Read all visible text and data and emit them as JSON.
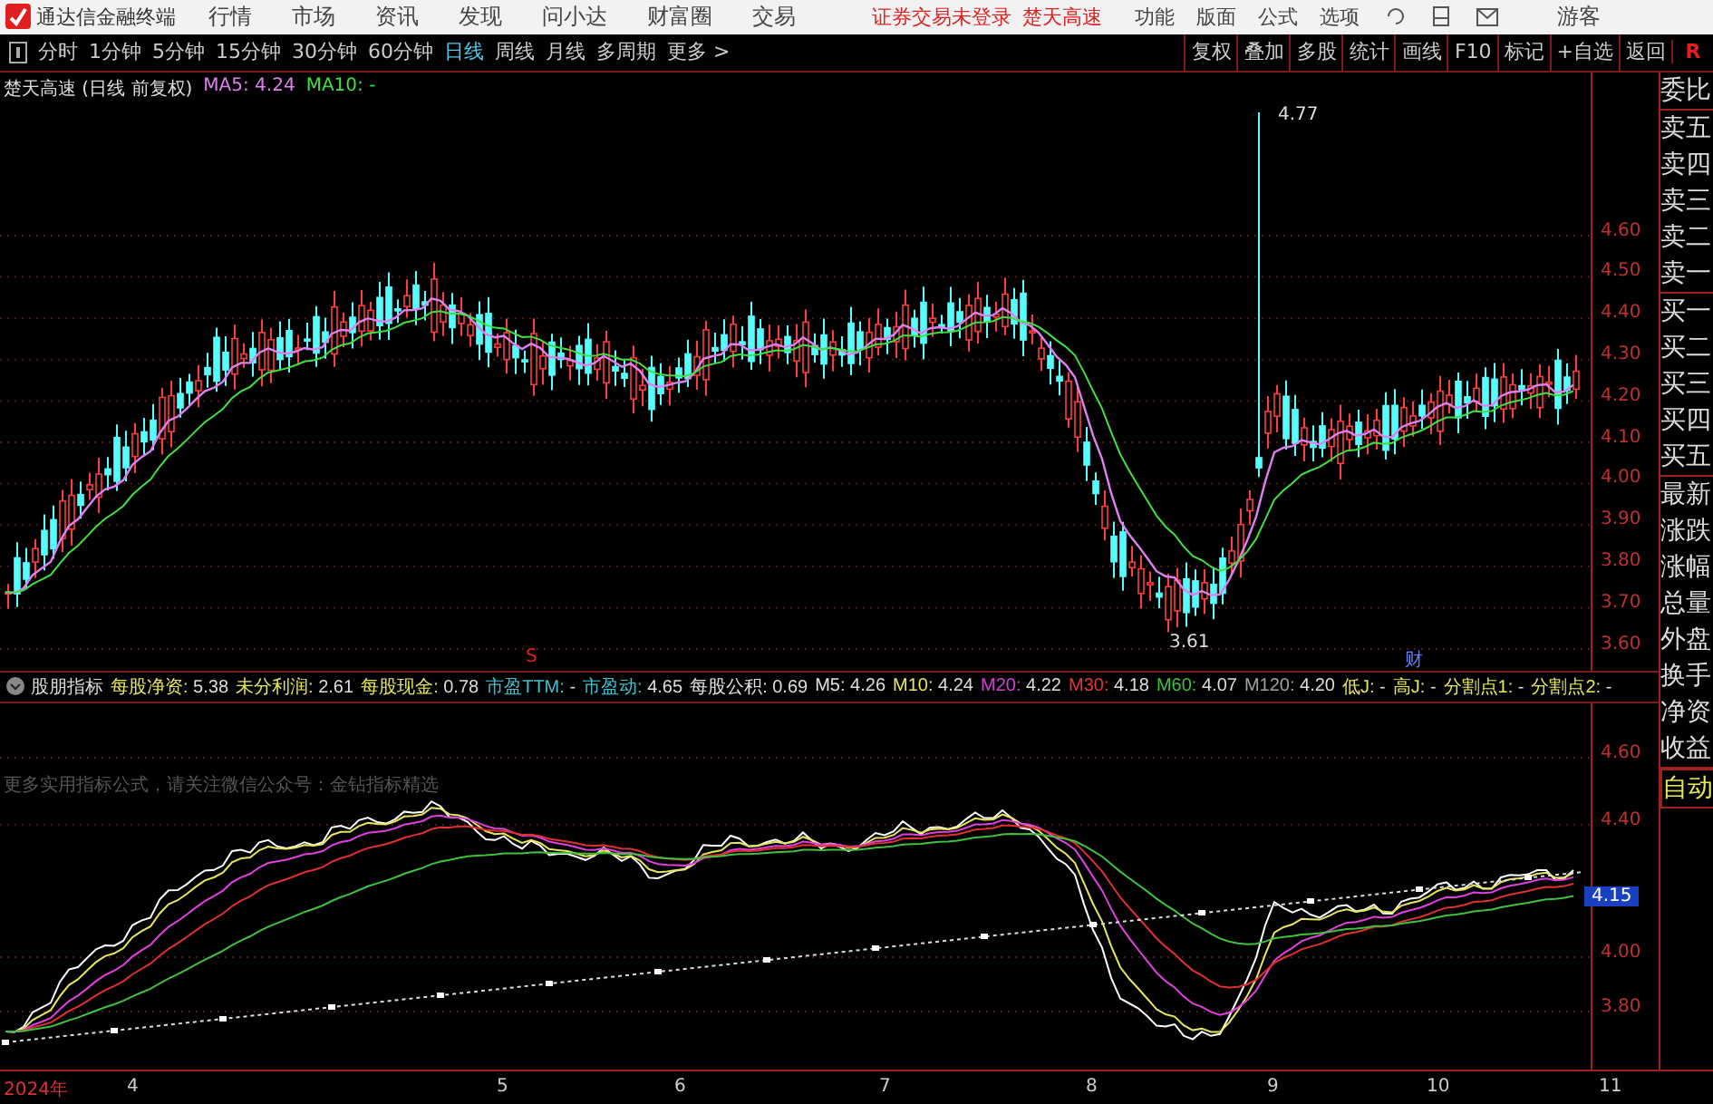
{
  "app_bar": {
    "app_name": "通达信金融终端",
    "menu": [
      "行情",
      "市场",
      "资讯",
      "发现",
      "问小达",
      "财富圈",
      "交易"
    ],
    "login_status": "证券交易未登录",
    "stock_name": "楚天高速",
    "tools": [
      "功能",
      "版面",
      "公式",
      "选项"
    ],
    "user": "游客"
  },
  "period_bar": {
    "items": [
      {
        "label": "分时",
        "selected": false
      },
      {
        "label": "1分钟",
        "selected": false
      },
      {
        "label": "5分钟",
        "selected": false
      },
      {
        "label": "15分钟",
        "selected": false
      },
      {
        "label": "30分钟",
        "selected": false
      },
      {
        "label": "60分钟",
        "selected": false
      },
      {
        "label": "日线",
        "selected": true
      },
      {
        "label": "周线",
        "selected": false
      },
      {
        "label": "月线",
        "selected": false
      },
      {
        "label": "多周期",
        "selected": false
      },
      {
        "label": "更多 >",
        "selected": false
      }
    ],
    "buttons": [
      "复权",
      "叠加",
      "多股",
      "统计",
      "画线",
      "F10",
      "标记",
      "+自选",
      "返回"
    ],
    "corner": "R"
  },
  "main_chart": {
    "title": "楚天高速 (日线 前复权)",
    "legend": [
      {
        "label": "MA5: 4.24",
        "color": "#e080f0"
      },
      {
        "label": "MA10: -",
        "color": "#40e040"
      }
    ],
    "y_ticks": [
      "4.60",
      "4.50",
      "4.40",
      "4.30",
      "4.20",
      "4.10",
      "4.00",
      "3.90",
      "3.80",
      "3.70",
      "3.60"
    ],
    "high_label": "4.77",
    "low_label": "3.61",
    "markers": [
      "S",
      "财"
    ]
  },
  "indicator": {
    "name": "股朋指标",
    "fields": [
      {
        "label": "每股净资:",
        "value": "5.38",
        "color": "#e6e65a"
      },
      {
        "label": "未分利润:",
        "value": "2.61",
        "color": "#e6e65a"
      },
      {
        "label": "每股现金:",
        "value": "0.78",
        "color": "#e6e65a"
      },
      {
        "label": "市盈TTM:",
        "value": "-",
        "color": "#40c0d0"
      },
      {
        "label": "市盈动:",
        "value": "4.65",
        "color": "#40c0d0"
      },
      {
        "label": "每股公积:",
        "value": "0.69",
        "color": "#e0e0e0"
      },
      {
        "label": "M5:",
        "value": "4.26",
        "color": "#e0e0e0"
      },
      {
        "label": "M10:",
        "value": "4.24",
        "color": "#e6e65a"
      },
      {
        "label": "M20:",
        "value": "4.22",
        "color": "#d040d0"
      },
      {
        "label": "M30:",
        "value": "4.18",
        "color": "#e03838"
      },
      {
        "label": "M60:",
        "value": "4.07",
        "color": "#40c040"
      },
      {
        "label": "M120:",
        "value": "4.20",
        "color": "#a0a0a0"
      },
      {
        "label": "低J:",
        "value": "-",
        "color": "#e6e65a"
      },
      {
        "label": "高J:",
        "value": "-",
        "color": "#e6e65a"
      },
      {
        "label": "分割点1:",
        "value": "-",
        "color": "#e6e65a"
      },
      {
        "label": "分割点2:",
        "value": "-",
        "color": "#e6e65a"
      }
    ],
    "note": "更多实用指标公式，请关注微信公众号：金钻指标精选",
    "y_ticks": [
      "4.60",
      "4.40",
      "4.00",
      "3.80"
    ],
    "current_value": "4.15"
  },
  "quote_panel": {
    "groups": [
      [
        "委比"
      ],
      [
        "卖五",
        "卖四",
        "卖三",
        "卖二",
        "卖一"
      ],
      [
        "买一",
        "买二",
        "买三",
        "买四",
        "买五"
      ],
      [
        "最新",
        "涨跌",
        "涨幅",
        "总量",
        "外盘",
        "换手",
        "净资",
        "收益"
      ]
    ],
    "mode": "自动"
  },
  "x_axis": [
    "2024年",
    "4",
    "5",
    "6",
    "7",
    "8",
    "9",
    "10",
    "11"
  ]
}
